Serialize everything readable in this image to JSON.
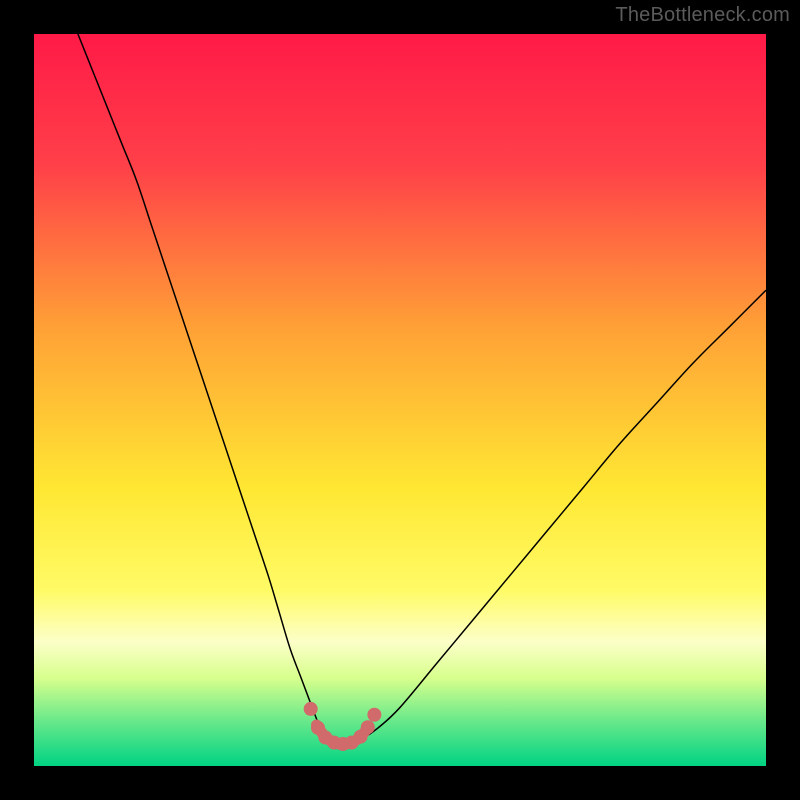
{
  "attribution": "TheBottleneck.com",
  "chart_data": {
    "type": "line",
    "title": "",
    "xlabel": "",
    "ylabel": "",
    "xlim": [
      0,
      100
    ],
    "ylim": [
      0,
      100
    ],
    "grid": false,
    "legend": false,
    "background_gradient": {
      "type": "vertical",
      "stops": [
        {
          "offset": 0.0,
          "color": "#ff1a47"
        },
        {
          "offset": 0.18,
          "color": "#ff4049"
        },
        {
          "offset": 0.4,
          "color": "#ffa036"
        },
        {
          "offset": 0.62,
          "color": "#ffe733"
        },
        {
          "offset": 0.76,
          "color": "#fffb66"
        },
        {
          "offset": 0.83,
          "color": "#fcffc8"
        },
        {
          "offset": 0.88,
          "color": "#d7ff8d"
        },
        {
          "offset": 0.94,
          "color": "#66e88a"
        },
        {
          "offset": 1.0,
          "color": "#00d383"
        }
      ]
    },
    "series": [
      {
        "name": "bottleneck-curve",
        "color": "#000000",
        "stroke_width": 1.5,
        "x": [
          6,
          8,
          10,
          12,
          14,
          16,
          18,
          20,
          22,
          24,
          26,
          28,
          30,
          32,
          33.5,
          35,
          36.5,
          38,
          39,
          40,
          41,
          42,
          43,
          44,
          45,
          47,
          50,
          55,
          60,
          65,
          70,
          75,
          80,
          85,
          90,
          95,
          100
        ],
        "y": [
          100,
          95,
          90,
          85,
          80,
          74,
          68,
          62,
          56,
          50,
          44,
          38,
          32,
          26,
          21,
          16,
          12,
          8,
          5.5,
          4,
          3.3,
          3.0,
          3.0,
          3.2,
          3.8,
          5.2,
          8,
          14,
          20,
          26,
          32,
          38,
          44,
          49.5,
          55,
          60,
          65
        ]
      }
    ],
    "markers": {
      "name": "valley-dots",
      "color": "#d16a6a",
      "radius": 7,
      "points": [
        {
          "x": 37.8,
          "y": 7.8
        },
        {
          "x": 38.8,
          "y": 5.2
        },
        {
          "x": 39.8,
          "y": 3.9
        },
        {
          "x": 41.0,
          "y": 3.2
        },
        {
          "x": 42.2,
          "y": 3.0
        },
        {
          "x": 43.4,
          "y": 3.2
        },
        {
          "x": 44.6,
          "y": 4.0
        },
        {
          "x": 45.6,
          "y": 5.3
        },
        {
          "x": 46.5,
          "y": 7.0
        }
      ],
      "thick_segment": {
        "color": "#d16a6a",
        "stroke_width": 11,
        "x": [
          38.6,
          39.6,
          40.6,
          41.6,
          42.6,
          43.6,
          44.6,
          45.6
        ],
        "y": [
          5.6,
          4.2,
          3.4,
          3.0,
          3.0,
          3.3,
          4.0,
          5.2
        ]
      }
    }
  }
}
